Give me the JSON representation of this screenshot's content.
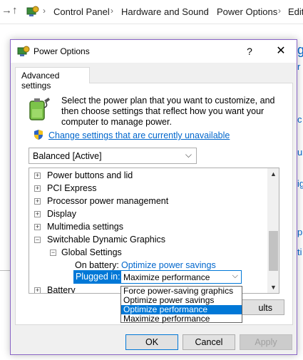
{
  "address_bar": {
    "crumbs": [
      "Control Panel",
      "Hardware and Sound",
      "Power Options",
      "Edit"
    ]
  },
  "background": {
    "fragments": [
      "g",
      "r",
      "c",
      "u",
      "ig",
      "p",
      "ti"
    ]
  },
  "dialog": {
    "title": "Power Options",
    "help": "?",
    "close": "✕",
    "tab": "Advanced settings",
    "description": "Select the power plan that you want to customize, and then choose settings that reflect how you want your computer to manage power.",
    "change_link": "Change settings that are currently unavailable",
    "plan_select": "Balanced [Active]",
    "tree": [
      {
        "label": "Power buttons and lid",
        "expander": "+"
      },
      {
        "label": "PCI Express",
        "expander": "+"
      },
      {
        "label": "Processor power management",
        "expander": "+"
      },
      {
        "label": "Display",
        "expander": "+"
      },
      {
        "label": "Multimedia settings",
        "expander": "+"
      },
      {
        "label": "Switchable Dynamic Graphics",
        "expander": "−"
      },
      {
        "label": "Global Settings",
        "expander": "−"
      },
      {
        "label": "Battery",
        "expander": "+"
      }
    ],
    "on_battery_label": "On battery:",
    "on_battery_value": "Optimize power savings",
    "plugged_in_label": "Plugged in:",
    "plugged_in_value": "Maximize performance",
    "dropdown_options": [
      "Force power-saving graphics",
      "Optimize power savings",
      "Optimize performance",
      "Maximize performance"
    ],
    "dropdown_highlighted": "Optimize performance",
    "restore_button": "ults",
    "ok": "OK",
    "cancel": "Cancel",
    "apply": "Apply"
  },
  "colors": {
    "accent": "#0078d7",
    "link": "#0066cc",
    "dialog_border": "#8a65c6"
  },
  "icons": [
    "back-arrow-icon",
    "up-arrow-icon",
    "control-panel-icon",
    "power-options-icon",
    "battery-plug-icon",
    "uac-shield-icon",
    "chevron-down-icon"
  ]
}
